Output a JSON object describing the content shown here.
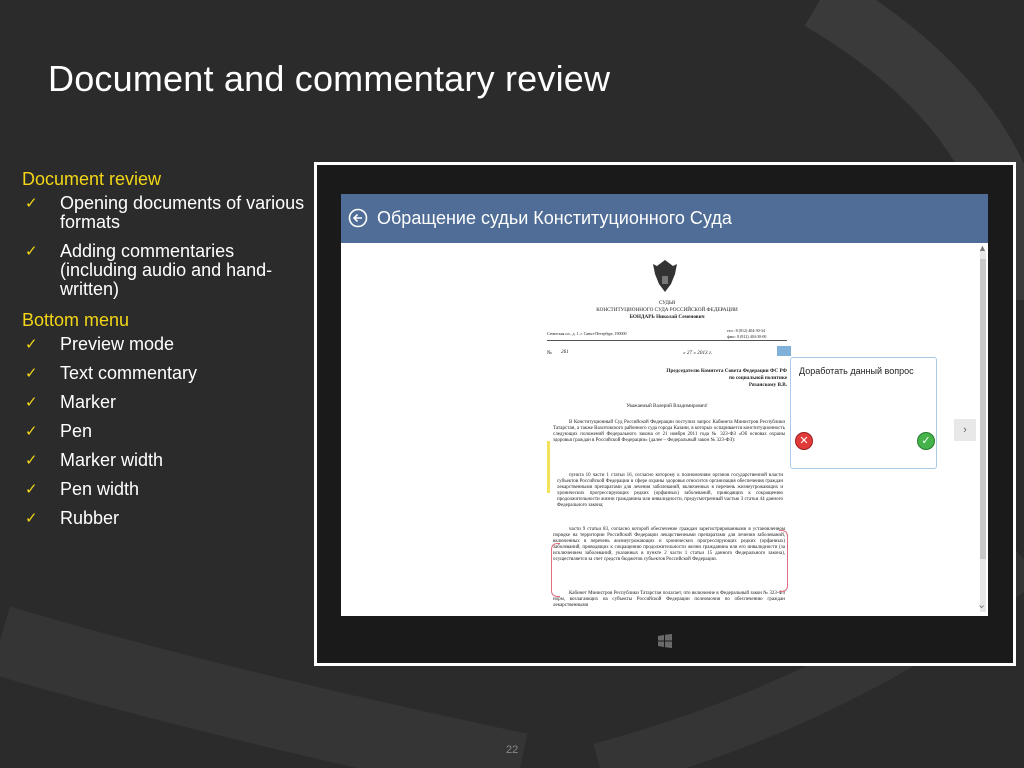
{
  "slide": {
    "title": "Document and commentary review",
    "page_number": "22"
  },
  "outline": {
    "section1": "Document review",
    "bullets1": [
      "Opening documents of various formats",
      "Adding commentaries (including audio and hand-written)"
    ],
    "section2": "Bottom menu",
    "bullets2": [
      "Preview mode",
      "Text commentary",
      "Marker",
      "Pen",
      "Marker width",
      "Pen width",
      "Rubber"
    ]
  },
  "app": {
    "title": "Обращение судьи Конституционного Суда",
    "back_icon": "back-arrow-icon",
    "next_icon": "chevron-right-icon"
  },
  "document": {
    "hdr1": "СУДЬЯ",
    "hdr2": "КОНСТИТУЦИОННОГО СУДА РОССИЙСКОЙ ФЕДЕРАЦИИ",
    "hdr3": "БОНДАРЬ Николай Семенович",
    "addr": "Сенатская пл., д. 1, г. Санкт-Петербург, 190000",
    "phones": "тел.: 8 (812) 404-30-34",
    "fax": "факс: 8 (812) 404-30-00",
    "num": "№",
    "num_val": "261",
    "date": "« 27 » 2013 г.",
    "to1": "Председателю Комитета Совета Федерации ФС РФ",
    "to2": "по социальной политике",
    "to3": "Рязанскому В.В.",
    "greet": "Уважаемый Валерий Владимирович!",
    "p1": "В Конституционный Суд Российской Федерации поступил запрос Кабинета Министров Республики Татарстан, а также Вахитовского районного суда города Казани, в которых оспаривается конституционность следующих положений Федерального закона от 21 ноября 2011 года № 323-ФЗ «Об основах охраны здоровья граждан в Российской Федерации» (далее – Федеральный закон № 323-ФЗ):",
    "p2": "пункта 10 части 1 статьи 16, согласно которому к полномочиям органов государственной власти субъектов Российской Федерации в сфере охраны здоровья относится организация обеспечения граждан лекарственными препаратами для лечения заболеваний, включенных в перечень жизнеугрожающих и хронических прогрессирующих редких (орфанных) заболеваний, приводящих к сокращению продолжительности жизни гражданина или инвалидности, предусмотренный частью 3 статьи 44 данного Федерального закона;",
    "p3": "части 9 статьи 83, согласно которой обеспечение граждан зарегистрированными в установленном порядке на территории Российской Федерации лекарственными препаратами для лечения заболеваний, включенных в перечень жизнеугрожающих и хронических прогрессирующих редких (орфанных) заболеваний, приводящих к сокращению продолжительности жизни гражданина или его инвалидности (за исключением заболеваний, указанных в пункте 2 части 1 статьи 15 данного Федерального закона), осуществляется за счет средств бюджетов субъектов Российской Федерации.",
    "p4": "Кабинет Министров Республики Татарстан полагает, что включение в Федеральный закон № 323-ФЗ норм, возлагающих на субъекты Российской Федерации полномочия по обеспечению граждан лекарственными"
  },
  "comment": {
    "text": "Доработать данный вопрос",
    "reject_icon": "close-circle-icon",
    "accept_icon": "check-circle-icon"
  },
  "colors": {
    "background": "#2b2b2b",
    "accent_yellow": "#f2d617",
    "appbar": "#4f6d96"
  }
}
